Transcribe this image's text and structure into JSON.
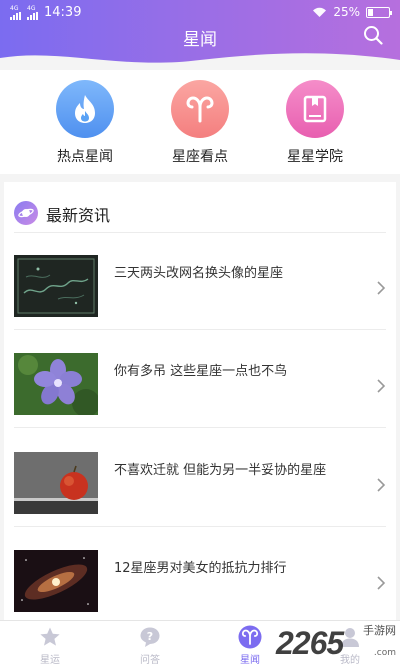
{
  "status_bar": {
    "time": "14:39",
    "network_1": "4G",
    "network_2": "4G",
    "battery": "25%",
    "battery_level": 0.25
  },
  "header": {
    "title": "星闻",
    "search_icon": "search-icon"
  },
  "categories": [
    {
      "label": "热点星闻",
      "icon": "flame-icon",
      "color": "#5aa2f5"
    },
    {
      "label": "星座看点",
      "icon": "aries-icon",
      "color": "#f7918f"
    },
    {
      "label": "星星学院",
      "icon": "book-icon",
      "color": "#ee6fb7"
    }
  ],
  "news": {
    "heading": "最新资讯",
    "items": [
      {
        "title": "三天两头改网名换头像的星座",
        "thumb": "dark-map"
      },
      {
        "title": "你有多吊 这些星座一点也不鸟",
        "thumb": "purple-flower"
      },
      {
        "title": "不喜欢迁就 但能为另一半妥协的星座",
        "thumb": "apple"
      },
      {
        "title": "12星座男对美女的抵抗力排行",
        "thumb": "galaxy"
      }
    ]
  },
  "tabbar": {
    "tabs": [
      {
        "label": "星运",
        "icon": "star-icon",
        "active": false
      },
      {
        "label": "问答",
        "icon": "question-icon",
        "active": false
      },
      {
        "label": "星闻",
        "icon": "aries-icon",
        "active": true
      },
      {
        "label": "我的",
        "icon": "user-icon",
        "active": false
      }
    ]
  },
  "watermark": {
    "number": "2265",
    "site": "手游网",
    "domain": ".com"
  },
  "colors": {
    "accent": "#7c6cf0",
    "header_start": "#7b6cf0",
    "header_end": "#b66fde"
  }
}
